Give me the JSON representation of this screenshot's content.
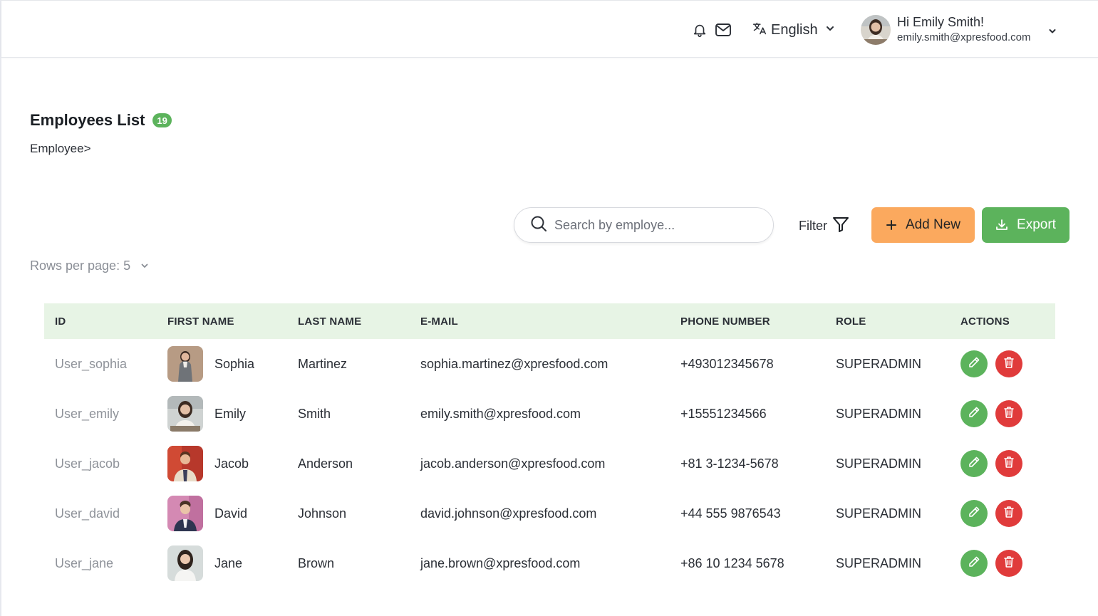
{
  "header": {
    "language": "English",
    "greeting": "Hi Emily Smith!",
    "email": "emily.smith@xpresfood.com"
  },
  "page": {
    "title": "Employees List",
    "count": "19",
    "breadcrumb": "Employee>"
  },
  "toolbar": {
    "search_placeholder": "Search by employe...",
    "filter_label": "Filter",
    "add_label": "Add New",
    "export_label": "Export",
    "rows_per_page": "Rows per page: 5"
  },
  "table": {
    "columns": [
      "ID",
      "FIRST NAME",
      "LAST NAME",
      "E-MAIL",
      "PHONE NUMBER",
      "ROLE",
      "ACTIONS"
    ],
    "rows": [
      {
        "id": "User_sophia",
        "first": "Sophia",
        "last": "Martinez",
        "email": "sophia.martinez@xpresfood.com",
        "phone": "+493012345678",
        "role": "SUPERADMIN"
      },
      {
        "id": "User_emily",
        "first": "Emily",
        "last": "Smith",
        "email": "emily.smith@xpresfood.com",
        "phone": "+15551234566",
        "role": "SUPERADMIN"
      },
      {
        "id": "User_jacob",
        "first": "Jacob",
        "last": "Anderson",
        "email": "jacob.anderson@xpresfood.com",
        "phone": "+81 3-1234-5678",
        "role": "SUPERADMIN"
      },
      {
        "id": "User_david",
        "first": "David",
        "last": "Johnson",
        "email": "david.johnson@xpresfood.com",
        "phone": "+44 555 9876543",
        "role": "SUPERADMIN"
      },
      {
        "id": "User_jane",
        "first": "Jane",
        "last": "Brown",
        "email": "jane.brown@xpresfood.com",
        "phone": "+86 10 1234 5678",
        "role": "SUPERADMIN"
      }
    ]
  },
  "colors": {
    "accent_green": "#5cb35c",
    "accent_orange": "#fba95e",
    "danger_red": "#e03b3b",
    "header_row_bg": "#e7f4e5"
  },
  "icons": [
    "bell-icon",
    "mail-icon",
    "translate-icon",
    "chevron-down-icon",
    "search-icon",
    "filter-icon",
    "plus-icon",
    "download-icon",
    "pencil-icon",
    "trash-icon"
  ]
}
